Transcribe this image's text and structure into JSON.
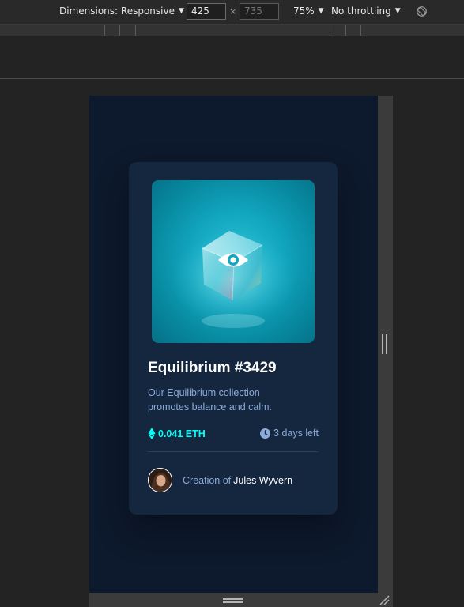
{
  "toolbar": {
    "dimensions_label": "Dimensions: Responsive",
    "width_value": "425",
    "height_value": "735",
    "times": "×",
    "zoom": "75%",
    "throttling": "No throttling",
    "rotate_icon": "rotate-icon"
  },
  "card": {
    "hero_icon": "eye-icon",
    "title": "Equilibrium #3429",
    "description_line1": "Our Equilibrium collection",
    "description_line2": "promotes balance and calm.",
    "price": "0.041 ETH",
    "time_left": "3 days left",
    "creator_prefix": "Creation of",
    "creator_name": "Jules Wyvern"
  },
  "colors": {
    "accent": "#00fff8",
    "muted": "#8bacd9",
    "card_bg": "#15263f",
    "page_bg": "#0d192c"
  }
}
